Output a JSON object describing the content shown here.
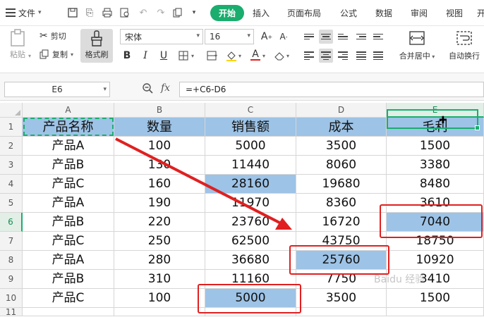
{
  "menubar": {
    "file_label": "文件",
    "tabs": [
      "开始",
      "插入",
      "页面布局",
      "公式",
      "数据",
      "审阅",
      "视图",
      "开"
    ],
    "active_tab": "开始"
  },
  "ribbon": {
    "paste_label": "粘贴",
    "cut_label": "剪切",
    "copy_label": "复制",
    "format_painter_label": "格式刷",
    "font_name": "宋体",
    "font_size": "16",
    "merge_label": "合并居中",
    "wrap_label": "自动换行"
  },
  "formula_bar": {
    "cell_ref": "E6",
    "fx_label": "fx",
    "formula": "=+C6-D6"
  },
  "sheet": {
    "columns": [
      "A",
      "B",
      "C",
      "D",
      "E"
    ],
    "rows": [
      "1",
      "2",
      "3",
      "4",
      "5",
      "6",
      "7",
      "8",
      "9",
      "10",
      "11"
    ],
    "header": [
      "产品名称",
      "数量",
      "销售额",
      "成本",
      "毛利"
    ],
    "data": [
      [
        "产品A",
        "100",
        "5000",
        "3500",
        "1500"
      ],
      [
        "产品B",
        "130",
        "11440",
        "8060",
        "3380"
      ],
      [
        "产品C",
        "160",
        "28160",
        "19680",
        "8480"
      ],
      [
        "产品A",
        "190",
        "11970",
        "8360",
        "3610"
      ],
      [
        "产品B",
        "220",
        "23760",
        "16720",
        "7040"
      ],
      [
        "产品C",
        "250",
        "62500",
        "43750",
        "18750"
      ],
      [
        "产品A",
        "280",
        "36680",
        "25760",
        "10920"
      ],
      [
        "产品B",
        "310",
        "11160",
        "7750",
        "3410"
      ],
      [
        "产品C",
        "100",
        "5000",
        "3500",
        "1500"
      ]
    ]
  },
  "colors": {
    "accent": "#1aad6e",
    "header_fill": "#9dc3e6",
    "annotation_red": "#e02020"
  },
  "watermark": "Baidu 经验"
}
